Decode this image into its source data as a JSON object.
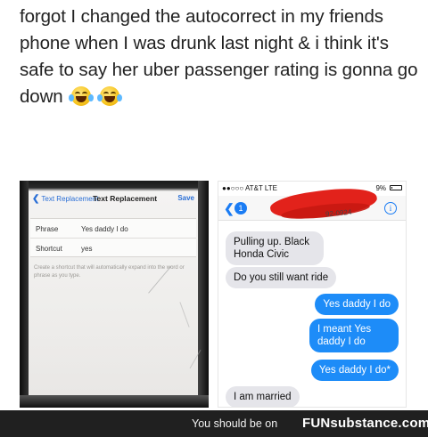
{
  "caption": {
    "text": "forgot I changed the autocorrect in my friends phone when I was drunk last night & i think it's safe to say her uber passenger rating is gonna go down",
    "emoji_1": "face-with-tears-of-joy",
    "emoji_2": "face-with-tears-of-joy"
  },
  "left_screen": {
    "back_label": "Text Replacement",
    "title": "Text Replacement",
    "save_label": "Save",
    "rows": [
      {
        "key": "Phrase",
        "value": "Yes daddy I do"
      },
      {
        "key": "Shortcut",
        "value": "yes"
      }
    ],
    "help_text": "Create a shortcut that will automatically expand into the word or phrase as you type."
  },
  "right_screen": {
    "carrier": "●●○○○ AT&T  LTE",
    "battery_text": "9%",
    "back_badge": "1",
    "number_fragment": "92-0924",
    "messages": [
      {
        "dir": "in",
        "text": "Pulling up. Black Honda Civic"
      },
      {
        "dir": "in",
        "text": "Do you still want ride"
      },
      {
        "dir": "out",
        "text": "Yes daddy I do"
      },
      {
        "dir": "out",
        "text": "I meant Yes daddy I do"
      },
      {
        "dir": "out",
        "text": "Yes daddy I do*"
      },
      {
        "dir": "in",
        "text": "I am married"
      }
    ]
  },
  "footer": {
    "note": "You should be on",
    "brand": "FUNsubstance.com"
  },
  "colors": {
    "ios_blue": "#1d8cf8",
    "incoming_gray": "#e5e5ea",
    "redaction_red": "#e2221b",
    "footer_bg": "#202020"
  }
}
